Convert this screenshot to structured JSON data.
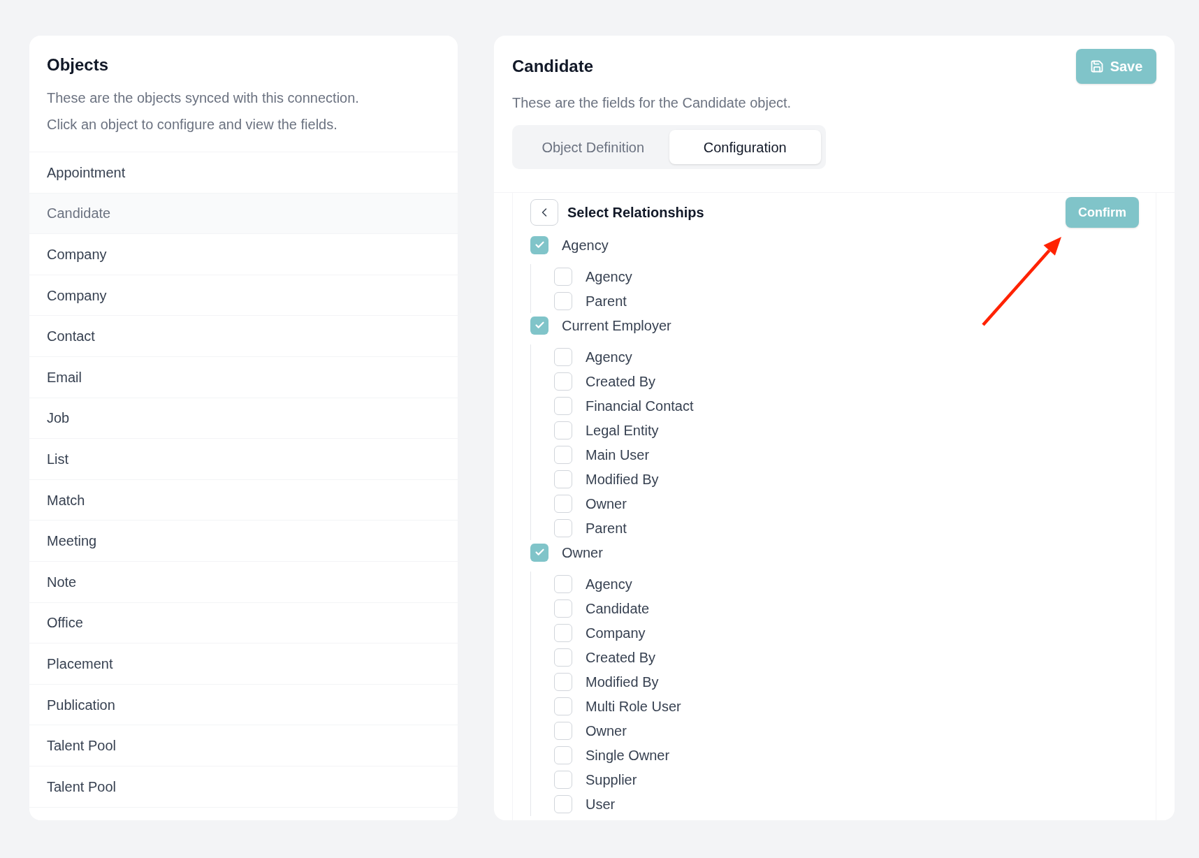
{
  "objects_panel": {
    "title": "Objects",
    "description": [
      "These are the objects synced with this connection.",
      "Click an object to configure and view the fields."
    ],
    "items": [
      {
        "label": "Appointment",
        "selected": false
      },
      {
        "label": "Candidate",
        "selected": true
      },
      {
        "label": "Company",
        "selected": false
      },
      {
        "label": "Company",
        "selected": false
      },
      {
        "label": "Contact",
        "selected": false
      },
      {
        "label": "Email",
        "selected": false
      },
      {
        "label": "Job",
        "selected": false
      },
      {
        "label": "List",
        "selected": false
      },
      {
        "label": "Match",
        "selected": false
      },
      {
        "label": "Meeting",
        "selected": false
      },
      {
        "label": "Note",
        "selected": false
      },
      {
        "label": "Office",
        "selected": false
      },
      {
        "label": "Placement",
        "selected": false
      },
      {
        "label": "Publication",
        "selected": false
      },
      {
        "label": "Talent Pool",
        "selected": false
      },
      {
        "label": "Talent Pool",
        "selected": false
      }
    ]
  },
  "detail_panel": {
    "title": "Candidate",
    "save_button": "Save",
    "description": "These are the fields for the Candidate object.",
    "tabs": [
      {
        "label": "Object Definition",
        "selected": false
      },
      {
        "label": "Configuration",
        "selected": true
      }
    ],
    "relationships": {
      "title": "Select Relationships",
      "confirm_button": "Confirm",
      "items": [
        {
          "label": "Agency",
          "checked": true,
          "children": [
            {
              "label": "Agency",
              "checked": false
            },
            {
              "label": "Parent",
              "checked": false
            }
          ]
        },
        {
          "label": "Current Employer",
          "checked": true,
          "children": [
            {
              "label": "Agency",
              "checked": false
            },
            {
              "label": "Created By",
              "checked": false
            },
            {
              "label": "Financial Contact",
              "checked": false
            },
            {
              "label": "Legal Entity",
              "checked": false
            },
            {
              "label": "Main User",
              "checked": false
            },
            {
              "label": "Modified By",
              "checked": false
            },
            {
              "label": "Owner",
              "checked": false
            },
            {
              "label": "Parent",
              "checked": false
            }
          ]
        },
        {
          "label": "Owner",
          "checked": true,
          "children": [
            {
              "label": "Agency",
              "checked": false
            },
            {
              "label": "Candidate",
              "checked": false
            },
            {
              "label": "Company",
              "checked": false
            },
            {
              "label": "Created By",
              "checked": false
            },
            {
              "label": "Modified By",
              "checked": false
            },
            {
              "label": "Multi Role User",
              "checked": false
            },
            {
              "label": "Owner",
              "checked": false
            },
            {
              "label": "Single Owner",
              "checked": false
            },
            {
              "label": "Supplier",
              "checked": false
            },
            {
              "label": "User",
              "checked": false
            }
          ]
        }
      ]
    }
  }
}
